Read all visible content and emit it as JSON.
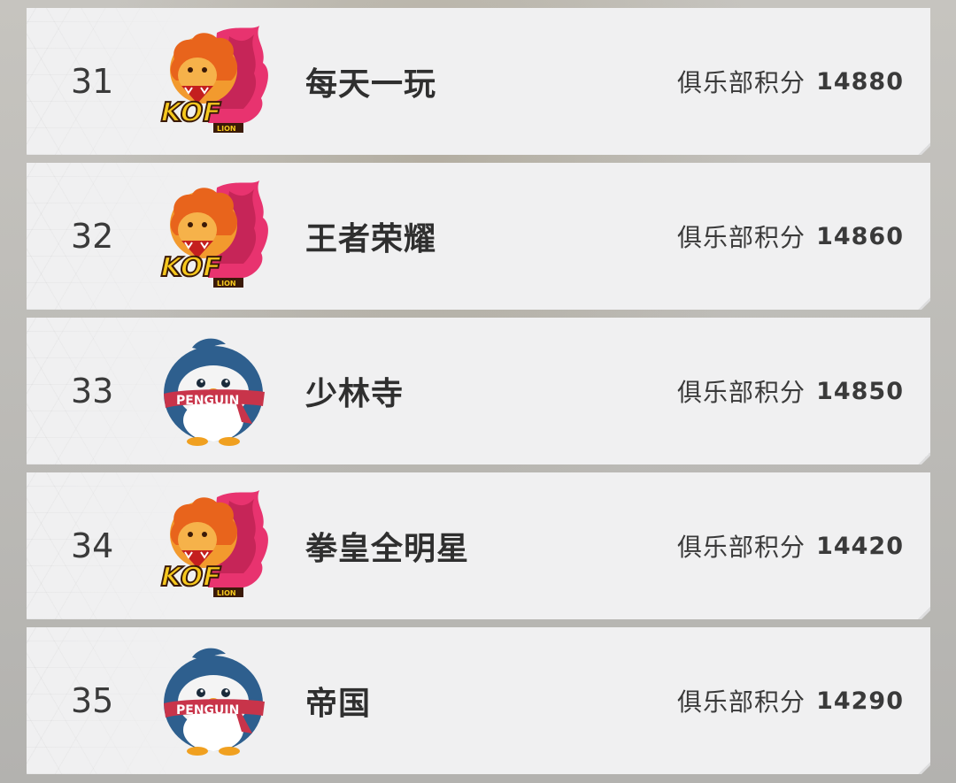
{
  "leaderboard": {
    "rows": [
      {
        "rank": "31",
        "name": "每天一玩",
        "score_label": "俱乐部积分",
        "score": "14880",
        "logo": "kof-lion-icon"
      },
      {
        "rank": "32",
        "name": "王者荣耀",
        "score_label": "俱乐部积分",
        "score": "14860",
        "logo": "kof-lion-icon"
      },
      {
        "rank": "33",
        "name": "少林寺",
        "score_label": "俱乐部积分",
        "score": "14850",
        "logo": "penguin-icon"
      },
      {
        "rank": "34",
        "name": "拳皇全明星",
        "score_label": "俱乐部积分",
        "score": "14420",
        "logo": "kof-lion-icon"
      },
      {
        "rank": "35",
        "name": "帝国",
        "score_label": "俱乐部积分",
        "score": "14290",
        "logo": "penguin-icon"
      }
    ]
  },
  "logos": {
    "kof-lion-icon": {
      "text_main": "KOF",
      "text_sub": "LION"
    },
    "penguin-icon": {
      "text_main": "PENGUIN"
    }
  },
  "colors": {
    "card_bg": "#f0f0f1",
    "text_dark": "#2f2f2f",
    "lion_yellow": "#f6c81e",
    "lion_orange": "#e8641c",
    "flame_pink": "#e8336f",
    "penguin_blue": "#2e5f8e",
    "scarf_red": "#c8344a"
  }
}
